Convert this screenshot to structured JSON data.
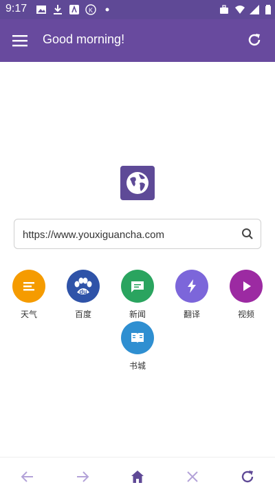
{
  "status_bar": {
    "time": "9:17",
    "left_icons": [
      "image-icon",
      "download-icon",
      "font-icon",
      "k-icon",
      "dot-icon"
    ],
    "right_icons": [
      "briefcase-icon",
      "wifi-icon",
      "signal-icon",
      "battery-icon"
    ]
  },
  "app_bar": {
    "title": "Good morning!",
    "color": "#684a9e"
  },
  "search": {
    "value": "https://www.youxiguancha.com"
  },
  "shortcuts": [
    {
      "label": "天气",
      "color": "#f59b00",
      "icon": "weather-icon"
    },
    {
      "label": "百度",
      "color": "#2f53a8",
      "icon": "baidu-icon"
    },
    {
      "label": "新闻",
      "color": "#2aa45f",
      "icon": "news-icon"
    },
    {
      "label": "翻译",
      "color": "#7c66da",
      "icon": "translate-icon"
    },
    {
      "label": "视频",
      "color": "#9c2aa2",
      "icon": "video-icon"
    },
    {
      "label": "书城",
      "color": "#2f8fd1",
      "icon": "book-icon"
    }
  ],
  "bottom_nav": [
    "back-icon",
    "forward-icon",
    "home-icon",
    "close-icon",
    "refresh-icon"
  ]
}
